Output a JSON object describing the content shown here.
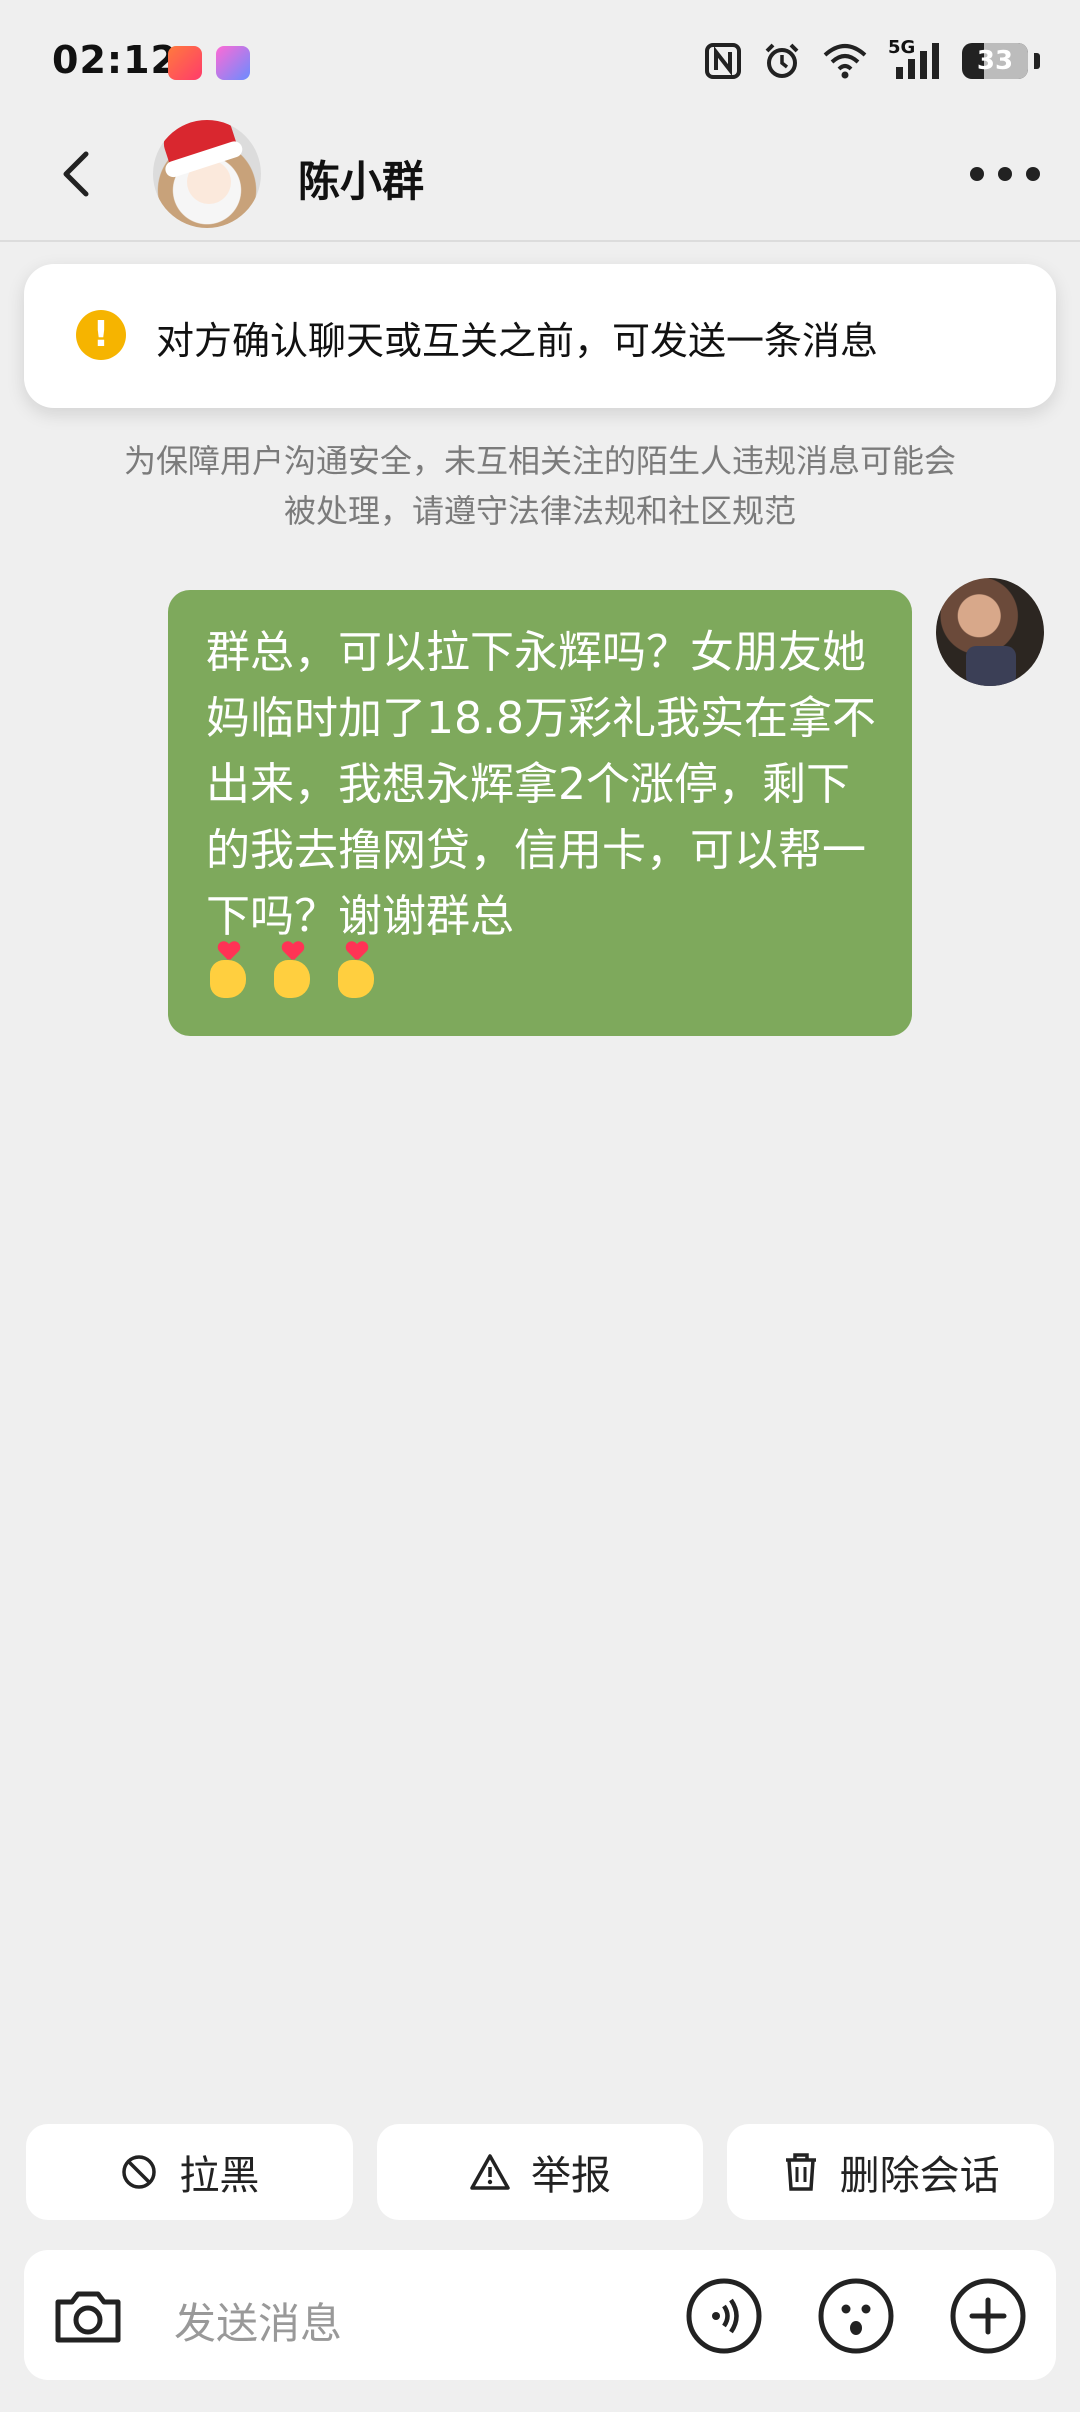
{
  "status_bar": {
    "time": "02:12",
    "battery": "33",
    "battery_level_percent": 33,
    "network": "5G",
    "icons": [
      "nfc-icon",
      "alarm-icon",
      "wifi-icon",
      "signal-icon",
      "battery-icon"
    ]
  },
  "header": {
    "title": "陈小群",
    "back_icon": "chevron-left-icon",
    "more_icon": "more-dots-icon"
  },
  "notice": {
    "icon": "warning-icon",
    "icon_glyph": "!",
    "text": "对方确认聊天或互关之前，可发送一条消息"
  },
  "safety_text": "为保障用户沟通安全，未互相关注的陌生人违规消息可能会被处理，请遵守法律法规和社区规范",
  "message": {
    "text": "群总，可以拉下永辉吗？女朋友她妈临时加了18.8万彩礼我实在拿不出来，我想永辉拿2个涨停，剩下的我去撸网贷，信用卡，可以帮一下吗？谢谢群总",
    "emoji": "finger-heart",
    "emoji_count": 3,
    "bubble_color": "#7ea95c"
  },
  "actions": [
    {
      "label": "拉黑",
      "icon": "block-icon"
    },
    {
      "label": "举报",
      "icon": "warning-triangle-icon"
    },
    {
      "label": "删除会话",
      "icon": "trash-icon"
    }
  ],
  "input": {
    "placeholder": "发送消息",
    "icons": [
      "camera-icon",
      "voice-icon",
      "emoji-icon",
      "plus-icon"
    ]
  }
}
